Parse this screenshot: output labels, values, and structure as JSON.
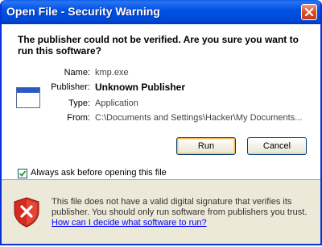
{
  "window": {
    "title": "Open File - Security Warning"
  },
  "dialog": {
    "headline": "The publisher could not be verified.  Are you sure you want to run this software?",
    "fields": [
      {
        "label": "Name:",
        "value": "kmp.exe"
      },
      {
        "label": "Publisher:",
        "value": "Unknown Publisher"
      },
      {
        "label": "Type:",
        "value": "Application"
      },
      {
        "label": "From:",
        "value": "C:\\Documents and Settings\\Hacker\\My Documents..."
      }
    ],
    "buttons": {
      "run": "Run",
      "cancel": "Cancel"
    },
    "checkbox": {
      "label": "Always ask before opening this file",
      "checked": true
    },
    "warning": {
      "text": "This file does not have a valid digital signature that verifies its publisher.  You should only run software from publishers you trust.",
      "link": "How can I decide what software to run?"
    }
  },
  "icons": {
    "close": "close-icon",
    "app": "application-icon",
    "shield": "shield-warning-icon",
    "check": "checkmark-icon"
  },
  "colors": {
    "titlebar": "#0053e6",
    "dialog_bg": "#ece9d8",
    "link": "#0000ff",
    "close_button": "#e0502c",
    "shield_red": "#d42a1f"
  }
}
